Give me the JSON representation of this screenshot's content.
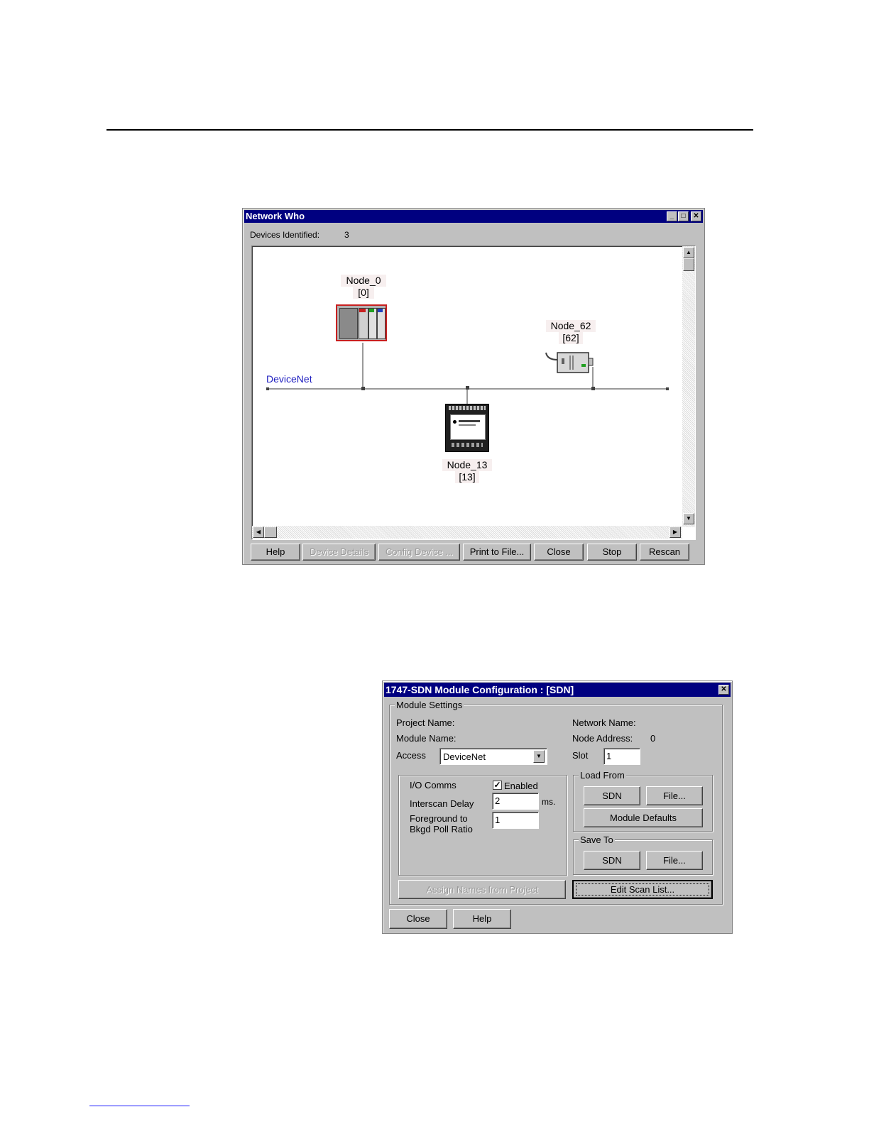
{
  "network_who": {
    "title": "Network Who",
    "devices_identified_label": "Devices Identified:",
    "devices_identified_value": "3",
    "network_label": "DeviceNet",
    "nodes": [
      {
        "name": "Node_0",
        "address": "[0]"
      },
      {
        "name": "Node_62",
        "address": "[62]"
      },
      {
        "name": "Node_13",
        "address": "[13]"
      }
    ],
    "buttons": {
      "help": "Help",
      "device_details": "Device Details",
      "config_device": "Config Device ...",
      "print_to_file": "Print to File...",
      "close": "Close",
      "stop": "Stop",
      "rescan": "Rescan"
    }
  },
  "sdn_config": {
    "title": "1747-SDN Module Configuration : [SDN]",
    "module_settings_label": "Module Settings",
    "project_name_label": "Project Name:",
    "module_name_label": "Module Name:",
    "access_label": "Access",
    "access_value": "DeviceNet",
    "network_name_label": "Network Name:",
    "node_address_label": "Node Address:",
    "node_address_value": "0",
    "slot_label": "Slot",
    "slot_value": "1",
    "io_comms_label": "I/O Comms",
    "enabled_label": "Enabled",
    "enabled_checked": true,
    "interscan_delay_label": "Interscan Delay",
    "interscan_delay_value": "2",
    "ms_label": "ms.",
    "foreground_label_1": "Foreground to",
    "foreground_label_2": "Bkgd Poll Ratio",
    "foreground_value": "1",
    "load_from_label": "Load From",
    "load_sdn": "SDN",
    "load_file": "File...",
    "module_defaults": "Module Defaults",
    "save_to_label": "Save To",
    "save_sdn": "SDN",
    "save_file": "File...",
    "assign_names": "Assign Names from Project",
    "edit_scan_list": "Edit Scan List...",
    "close": "Close",
    "help": "Help"
  }
}
